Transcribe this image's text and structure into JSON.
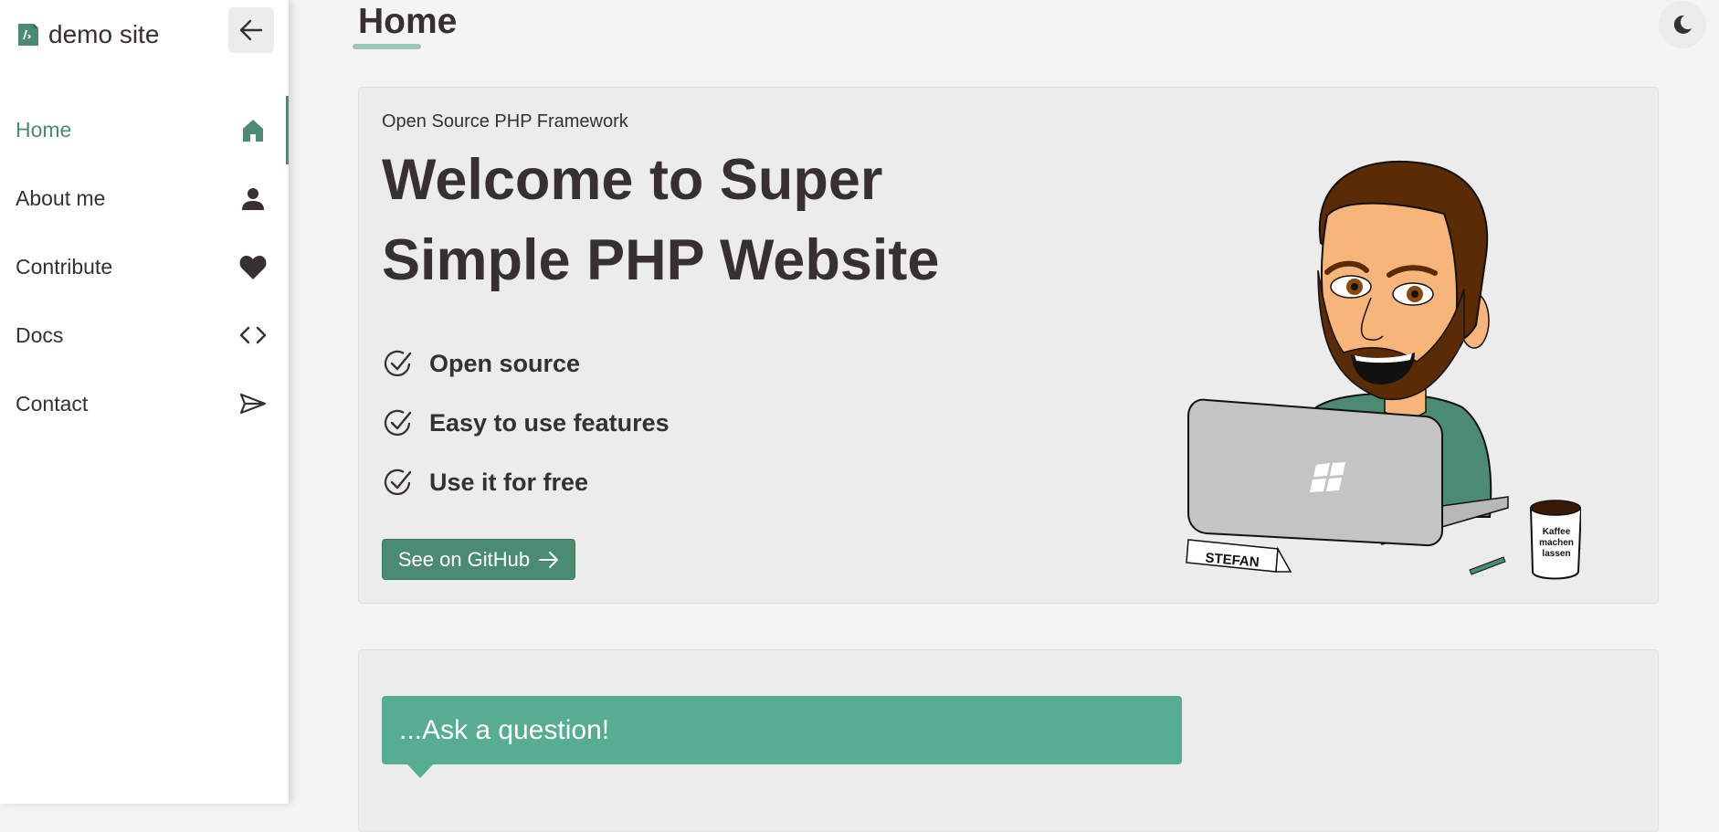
{
  "sidebar": {
    "brand": "demo site",
    "items": [
      {
        "label": "Home",
        "icon": "home-icon",
        "active": true
      },
      {
        "label": "About me",
        "icon": "person-icon"
      },
      {
        "label": "Contribute",
        "icon": "heart-icon"
      },
      {
        "label": "Docs",
        "icon": "code-icon"
      },
      {
        "label": "Contact",
        "icon": "send-icon"
      }
    ]
  },
  "header": {
    "title": "Home"
  },
  "hero": {
    "eyebrow": "Open Source PHP Framework",
    "headline_line1": "Welcome to Super",
    "headline_line2": "Simple PHP Website",
    "features": [
      "Open source",
      "Easy to use features",
      "Use it for free"
    ],
    "button_label": "See on GitHub",
    "illustration": {
      "name_tag": "STEFAN",
      "mug_text": [
        "Kaffee",
        "machen",
        "lassen"
      ]
    }
  },
  "question": {
    "label": "...Ask a question!"
  },
  "colors": {
    "accent": "#4a8b72",
    "accent_light": "#57ad91",
    "text": "#363030",
    "background": "#f4f4f4",
    "card": "#ececec"
  }
}
